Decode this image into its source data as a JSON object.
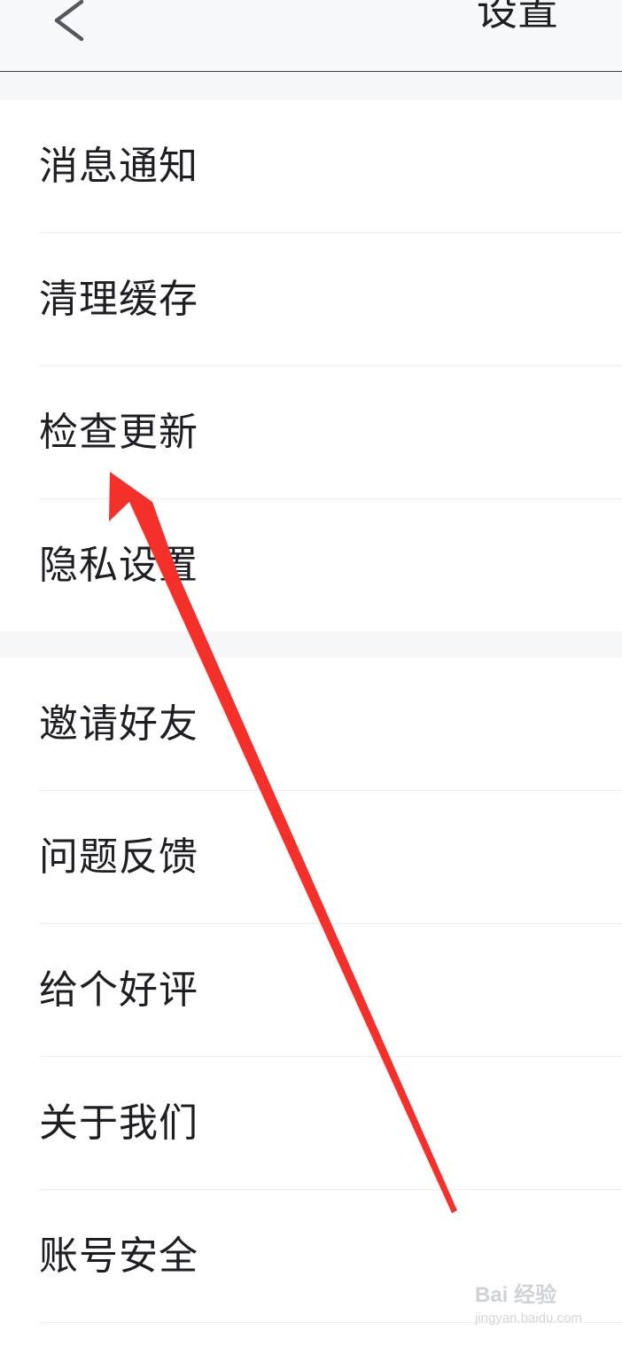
{
  "header": {
    "title": "设置",
    "back_icon": "chevron-left-icon"
  },
  "groups": [
    {
      "items": [
        {
          "label": "消息通知"
        },
        {
          "label": "清理缓存"
        },
        {
          "label": "检查更新"
        },
        {
          "label": "隐私设置"
        }
      ]
    },
    {
      "items": [
        {
          "label": "邀请好友"
        },
        {
          "label": "问题反馈"
        },
        {
          "label": "给个好评"
        },
        {
          "label": "关于我们"
        },
        {
          "label": "账号安全"
        }
      ]
    }
  ],
  "watermark": {
    "logo_text": "Bai 经验",
    "url_text": "jingyan.baidu.com"
  },
  "annotation": {
    "arrow_color": "#f5302a",
    "points_to": "检查更新"
  }
}
